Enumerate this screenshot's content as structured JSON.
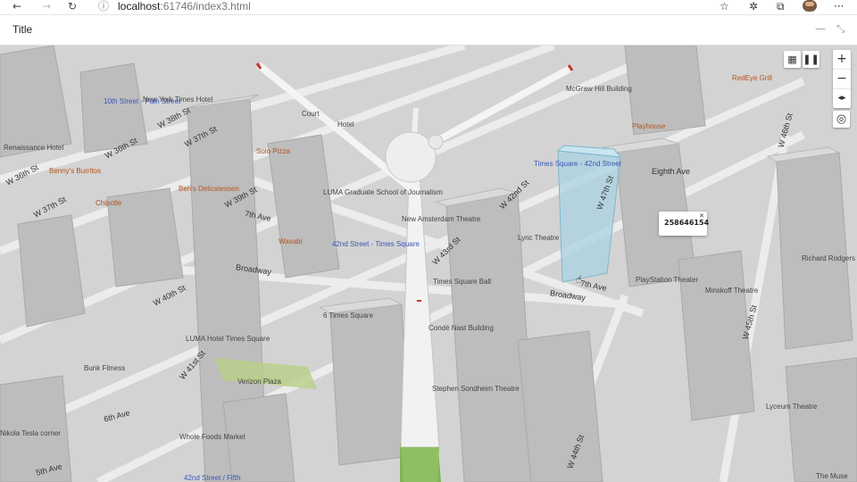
{
  "browser": {
    "url_host": "localhost",
    "url_path": ":61746/index3.html"
  },
  "app": {
    "title": "Title"
  },
  "popup": {
    "text": "258646154"
  },
  "labels": {
    "w36th_1": "W 36th St",
    "w37th_1": "W 37th St",
    "w36th_2": "W 36th St",
    "w37th_2": "W 37th St",
    "w38th_1": "W 38th St",
    "w39th_1": "W 39th St",
    "w40th_1": "W 40th St",
    "w41st_1": "W 41st St",
    "w42nd_1": "W 42nd St",
    "w43rd_1": "W 43rd St",
    "w44th_1": "W 44th St",
    "w45th_1": "W 45th St",
    "w47th_1": "W 47th St",
    "w46th_1": "W 46th St",
    "seventh_ave_1": "7th Ave",
    "seventh_ave_2": "7th Ave",
    "eighth_ave": "Eighth Ave",
    "broadway_1": "Broadway",
    "broadway_2": "Broadway",
    "sixth_ave": "6th Ave",
    "fifth_ave": "5th Ave",
    "renaissance": "Renaissance Hotel",
    "tenth_street": "10th Street - Path Street",
    "new_york_times": "New York Times Hotel",
    "court": "Court",
    "hotel": "Hotel",
    "bennys": "Benny's Burritos",
    "chipotle": "Chipotle",
    "solo_pizza": "Solo Pizza",
    "bens_deli": "Ben's Delicatessen",
    "luma_grad": "LUMA Graduate School of Journalism",
    "new_amsterdam": "New Amsterdam Theatre",
    "times_sq_42": "Times Square - 42nd Street",
    "lyric": "Lyric Theatre",
    "wasabi": "Wasabi",
    "station_42": "42nd Street - Times Square",
    "times_sq_ball": "Times Square Ball",
    "six_times": "6 Times Square",
    "conde_nast": "Condé Nast Building",
    "luma_hotel": "LUMA Hotel Times Square",
    "bunk": "Bunk Fitness",
    "verizon": "Verizon Plaza",
    "sondheim": "Stephen Sondheim Theatre",
    "whole_foods": "Whole Foods Market",
    "station_fifth": "42nd Street / Fifth",
    "tesla": "Nikola Tesla corner",
    "mcgraw": "McGraw Hill Building",
    "playstation": "PlayStation Theater",
    "minskoff": "Minskoff Theatre",
    "richard_rodgers": "Richard Rodgers Theatre",
    "lyceum": "Lyceum Theatre",
    "the_muse": "The Muse",
    "playhouse": "Playhouse",
    "redeye": "RedEye Grill"
  }
}
